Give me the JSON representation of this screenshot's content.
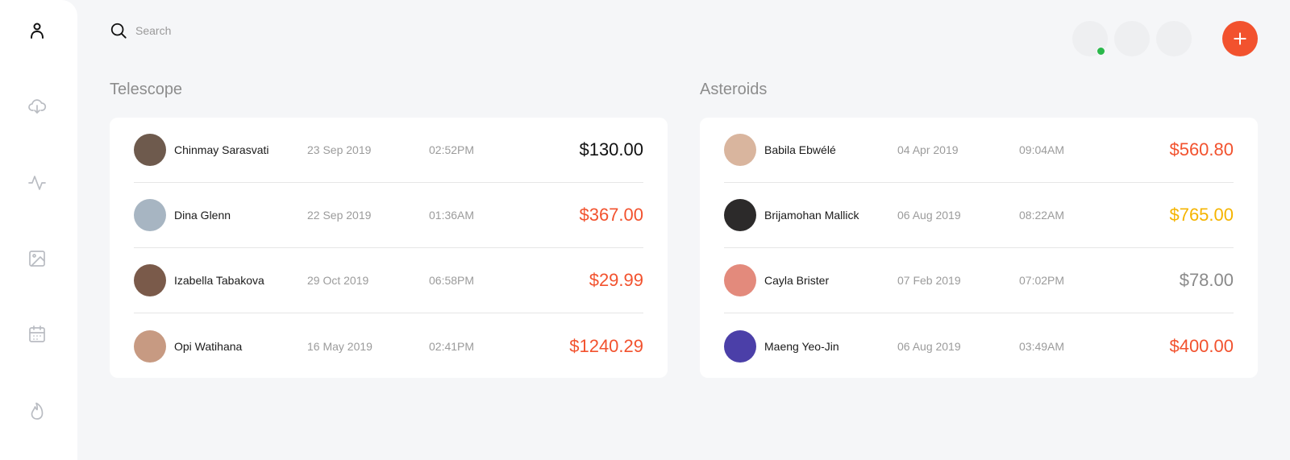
{
  "search": {
    "placeholder": "Search"
  },
  "sidebar": {
    "icons": [
      "user-icon",
      "cloud-download-icon",
      "activity-icon",
      "image-icon",
      "calendar-icon",
      "fire-icon"
    ]
  },
  "header": {
    "colors": {
      "accent": "#f2522e",
      "online": "#2bb84b"
    }
  },
  "sections": [
    {
      "title": "Telescope",
      "rows": [
        {
          "name": "Chinmay Sarasvati",
          "date": "23 Sep 2019",
          "time": "02:52PM",
          "amount": "$130.00",
          "color": "#111111",
          "avatar": "#6e5a4d"
        },
        {
          "name": "Dina Glenn",
          "date": "22 Sep 2019",
          "time": "01:36AM",
          "amount": "$367.00",
          "color": "#f2522e",
          "avatar": "#a7b5c2"
        },
        {
          "name": "Izabella Tabakova",
          "date": "29 Oct 2019",
          "time": "06:58PM",
          "amount": "$29.99",
          "color": "#f2522e",
          "avatar": "#7a5a4a"
        },
        {
          "name": "Opi Watihana",
          "date": "16 May 2019",
          "time": "02:41PM",
          "amount": "$1240.29",
          "color": "#f2522e",
          "avatar": "#c79a82"
        }
      ]
    },
    {
      "title": "Asteroids",
      "rows": [
        {
          "name": "Babila Ebwélé",
          "date": "04 Apr 2019",
          "time": "09:04AM",
          "amount": "$560.80",
          "color": "#f2522e",
          "avatar": "#d9b59e"
        },
        {
          "name": "Brijamohan Mallick",
          "date": "06 Aug 2019",
          "time": "08:22AM",
          "amount": "$765.00",
          "color": "#f5b400",
          "avatar": "#2c2a2a"
        },
        {
          "name": "Cayla Brister",
          "date": "07 Feb 2019",
          "time": "07:02PM",
          "amount": "$78.00",
          "color": "#8a8a8a",
          "avatar": "#e38a7c"
        },
        {
          "name": "Maeng Yeo-Jin",
          "date": "06 Aug 2019",
          "time": "03:49AM",
          "amount": "$400.00",
          "color": "#f2522e",
          "avatar": "#4b3fa8"
        }
      ]
    }
  ]
}
